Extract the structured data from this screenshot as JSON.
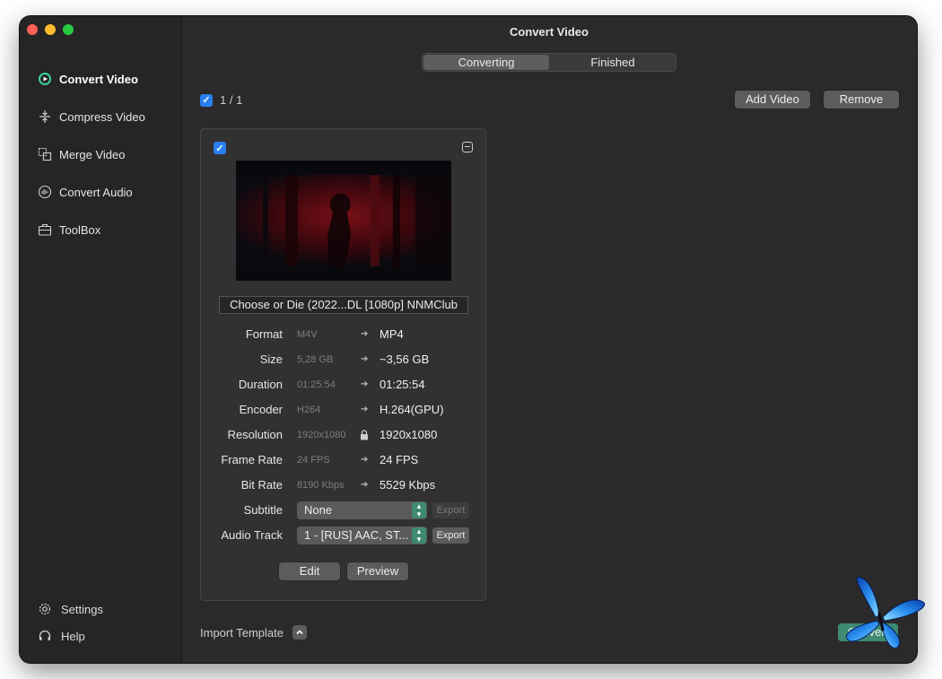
{
  "window": {
    "title": "Convert Video"
  },
  "sidebar": {
    "items": [
      {
        "label": "Convert Video",
        "icon": "convert-video-icon",
        "active": true
      },
      {
        "label": "Compress Video",
        "icon": "compress-icon"
      },
      {
        "label": "Merge Video",
        "icon": "merge-icon"
      },
      {
        "label": "Convert Audio",
        "icon": "audio-wave-icon"
      },
      {
        "label": "ToolBox",
        "icon": "toolbox-icon"
      }
    ],
    "footer": [
      {
        "label": "Settings",
        "icon": "gear-icon"
      },
      {
        "label": "Help",
        "icon": "headset-icon"
      }
    ]
  },
  "tabs": [
    {
      "label": "Converting",
      "active": true
    },
    {
      "label": "Finished",
      "active": false
    }
  ],
  "toolbar": {
    "count": "1 / 1",
    "add_video": "Add Video",
    "remove": "Remove"
  },
  "card": {
    "filename": "Choose or Die (2022...DL [1080p] NNMClub",
    "props": [
      {
        "label": "Format",
        "src": "M4V",
        "dst": "MP4"
      },
      {
        "label": "Size",
        "src": "5,28 GB",
        "dst": "~3,56 GB"
      },
      {
        "label": "Duration",
        "src": "01:25:54",
        "dst": "01:25:54"
      },
      {
        "label": "Encoder",
        "src": "H264",
        "dst": "H.264(GPU)"
      },
      {
        "label": "Resolution",
        "src": "1920x1080",
        "dst": "1920x1080"
      },
      {
        "label": "Frame Rate",
        "src": "24 FPS",
        "dst": "24 FPS"
      },
      {
        "label": "Bit Rate",
        "src": "8190 Kbps",
        "dst": "5529 Kbps"
      }
    ],
    "subtitle": {
      "label": "Subtitle",
      "value": "None",
      "export": "Export"
    },
    "audio": {
      "label": "Audio Track",
      "value": "1 - [RUS] AAC, ST...",
      "export": "Export"
    },
    "edit": "Edit",
    "preview": "Preview"
  },
  "bottom": {
    "import_template": "Import Template",
    "convert": "Convert"
  },
  "colors": {
    "accent_blue": "#2a7ff0",
    "convert_green": "#3e8a73",
    "window_bg": "#2a2a2a"
  }
}
